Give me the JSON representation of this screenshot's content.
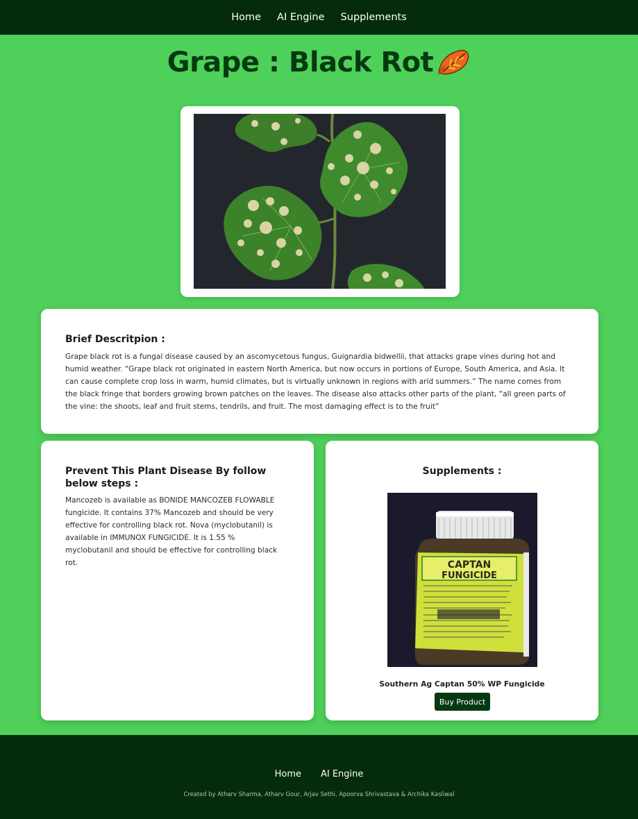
{
  "nav": {
    "items": [
      {
        "label": "Home"
      },
      {
        "label": "AI Engine"
      },
      {
        "label": "Supplements"
      }
    ]
  },
  "page": {
    "title": "Grape : Black Rot",
    "title_icon": "fallen-leaf-icon"
  },
  "hero_image": {
    "alt": "grape-leaves-black-rot-photo"
  },
  "description": {
    "heading": "Brief Descritpion :",
    "text": "Grape black rot is a fungal disease caused by an ascomycetous fungus, Guignardia bidwellii, that attacks grape vines during hot and humid weather. “Grape black rot originated in eastern North America, but now occurs in portions of Europe, South America, and Asia. It can cause complete crop loss in warm, humid climates, but is virtually unknown in regions with arid summers.” The name comes from the black fringe that borders growing brown patches on the leaves. The disease also attacks other parts of the plant, “all green parts of the vine: the shoots, leaf and fruit stems, tendrils, and fruit. The most damaging effect is to the fruit”"
  },
  "prevention": {
    "heading": "Prevent This Plant Disease By follow below steps :",
    "text": "Mancozeb is available as BONIDE MANCOZEB FLOWABLE fungicide. It contains 37% Mancozeb and should be very effective for controlling black rot. Nova (myclobutanil) is available in IMMUNOX FUNGICIDE. It is 1.55 % myclobutanil and should be effective for controlling black rot."
  },
  "supplements": {
    "heading": "Supplements :",
    "product_name": "Southern Ag Captan 50% WP Fungicide",
    "buy_label": "Buy Product",
    "label_lines": [
      "CAPTAN",
      "FUNGICIDE"
    ]
  },
  "footer": {
    "nav": [
      {
        "label": "Home"
      },
      {
        "label": "AI Engine"
      }
    ],
    "credits": "Created by Atharv Sharma, Atharv Gour, Arjav Sethi, Apoorva Shrivastava & Archika Kasliwal"
  },
  "colors": {
    "background": "#4fd05a",
    "nav_bg": "#042b0b",
    "title": "#053a10",
    "button": "#053a10"
  }
}
